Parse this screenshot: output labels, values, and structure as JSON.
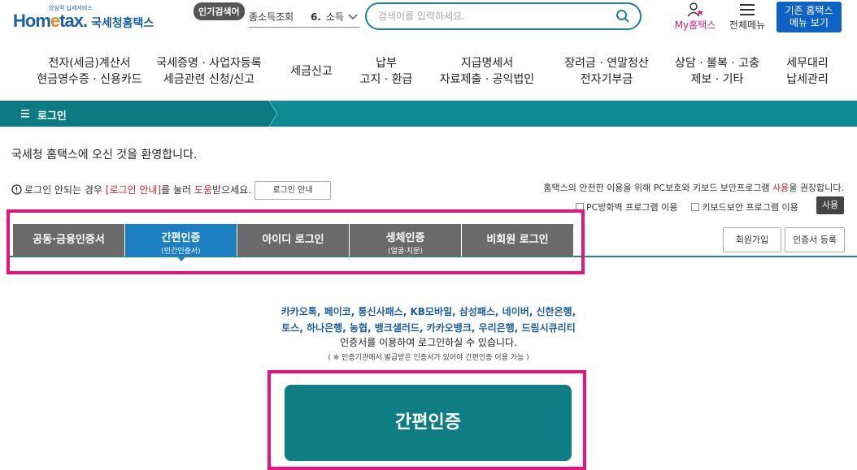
{
  "header": {
    "logo_tagline": "양심적 납세서비스",
    "logo_word": "Hometax.",
    "logo_name": "국세청홈택스",
    "popular_badge": "인기검색어",
    "popular_item1": "종소득조회",
    "popular_item2_num": "6.",
    "popular_item2_text": "소득",
    "search_placeholder": "검색어를 입력하세요.",
    "my_label": "My홈택스",
    "allmenu_label": "전체메뉴",
    "old_btn_line1": "기존 홈택스",
    "old_btn_line2": "메뉴 보기"
  },
  "nav": [
    {
      "line1": "전자(세금)계산서",
      "line2": "현금영수증 · 신용카드"
    },
    {
      "line1": "국세증명 · 사업자등록",
      "line2": "세금관련 신청/신고"
    },
    {
      "line1": "세금신고",
      "line2": ""
    },
    {
      "line1": "납부",
      "line2": "고지 · 환급"
    },
    {
      "line1": "지급명세서",
      "line2": "자료제출 · 공익법인"
    },
    {
      "line1": "장려금 · 연말정산",
      "line2": "전자기부금"
    },
    {
      "line1": "상담 · 불복 · 고충",
      "line2": "제보 · 기타"
    },
    {
      "line1": "세무대리",
      "line2": "납세관리"
    }
  ],
  "breadcrumb": {
    "label": "로그인"
  },
  "welcome": "국세청 홈택스에 오신 것을 환영합니다.",
  "help": {
    "pre": "로그인 안되는 경우 ",
    "red1": "[로그인 안내]",
    "mid": "를 눌러 ",
    "red2": "도움",
    "post": "받으세요.",
    "guide_btn": "로그인 안내"
  },
  "security": {
    "pre": "홈택스의 안전한 이용을 위해 PC보호와 키보드 보안프로그램 ",
    "red": "사용",
    "post": "을 권장합니다.",
    "chk1": "PC방화벽 프로그램 이용",
    "chk2": "키보드보안 프로그램 이용",
    "use_btn": "사용"
  },
  "tabs": [
    {
      "label": "공동·금융인증서",
      "sub": ""
    },
    {
      "label": "간편인증",
      "sub": "(민간인증서)"
    },
    {
      "label": "아이디 로그인",
      "sub": ""
    },
    {
      "label": "생체인증",
      "sub": "(얼굴·지문)"
    },
    {
      "label": "비회원 로그인",
      "sub": ""
    }
  ],
  "side_buttons": {
    "join": "회원가입",
    "cert": "인증서 등록"
  },
  "info": {
    "blue_line1": "카카오톡, 페이코, 통신사패스, KB모바일, 삼성패스, 네이버, 신한은행,",
    "blue_line2": "토스, 하나은행, 농협, 뱅크샐러드, 카카오뱅크, 우리은행, 드림시큐리티",
    "black": "인증서를 이용하여 로그인하실 수 있습니다.",
    "note": "( ※ 인증기관에서 발급받은 인증서가 있어야 간편인증 이용 가능 )"
  },
  "main_button": "간편인증",
  "colors": {
    "teal": "#0e8a92",
    "blue": "#1b7fc1",
    "highlight": "#e6157e"
  }
}
